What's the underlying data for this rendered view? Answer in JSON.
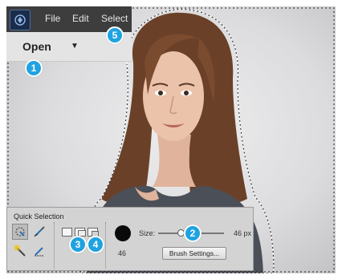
{
  "menu": {
    "logo_icon": "photoshop-elements-logo-icon",
    "items": [
      "File",
      "Edit",
      "Select"
    ]
  },
  "open_bar": {
    "label": "Open",
    "arrow_icon": "dropdown-triangle-icon"
  },
  "tool_options": {
    "title": "Quick Selection",
    "tools": [
      "quick-selection-tool-icon",
      "selection-brush-icon",
      "magic-wand-icon",
      "refine-selection-brush-icon"
    ],
    "modes": [
      "new-selection-icon",
      "add-to-selection-icon",
      "subtract-from-selection-icon"
    ],
    "brush_size_preview": "46",
    "size_label": "Size:",
    "size_value": "46 px",
    "size_fraction": 0.35,
    "brush_settings_label": "Brush Settings..."
  },
  "callouts": [
    "1",
    "2",
    "3",
    "4",
    "5"
  ],
  "colors": {
    "accent": "#1fa3e0",
    "menu_bg": "#3d3d3d",
    "panel_bg": "#d3d3d3"
  }
}
